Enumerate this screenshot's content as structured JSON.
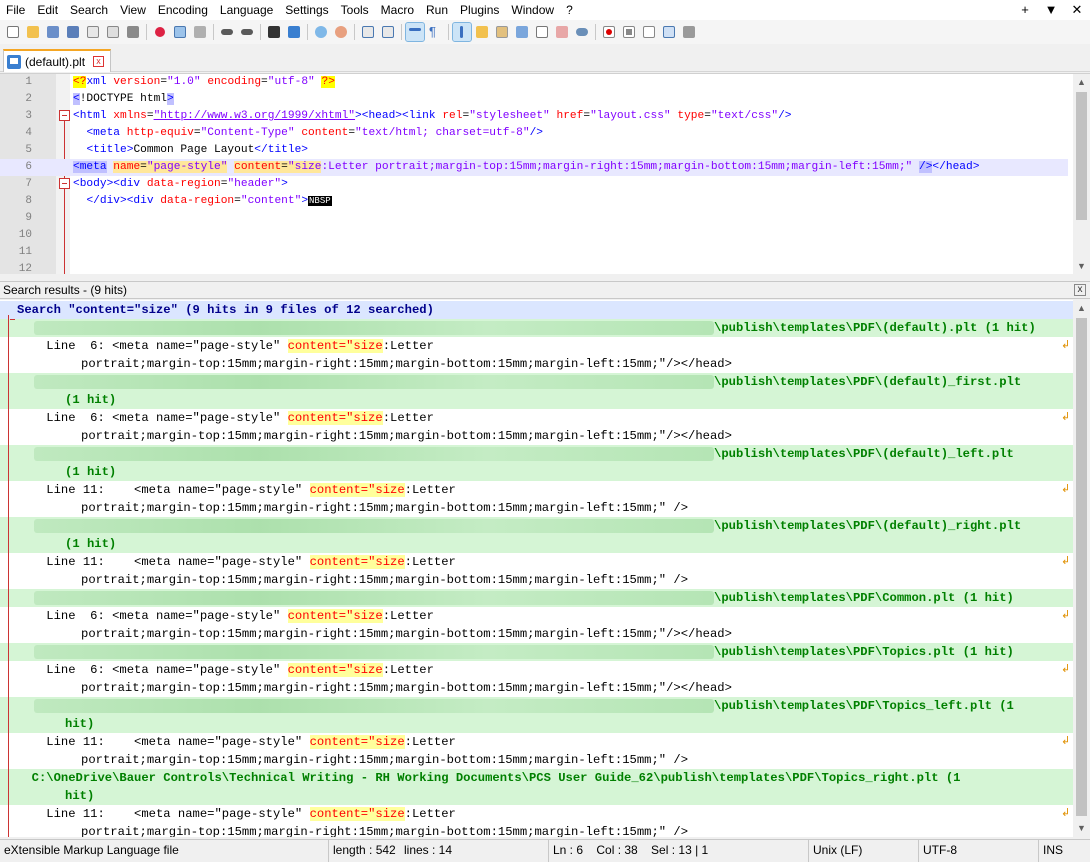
{
  "menu": [
    "File",
    "Edit",
    "Search",
    "View",
    "Encoding",
    "Language",
    "Settings",
    "Tools",
    "Macro",
    "Run",
    "Plugins",
    "Window",
    "?"
  ],
  "window_controls": [
    "+",
    "▼",
    "✕"
  ],
  "toolbar_icons": [
    "new-file-icon",
    "open-file-icon",
    "save-icon",
    "save-all-icon",
    "close-icon",
    "close-all-icon",
    "print-icon",
    "cut-icon",
    "copy-icon",
    "paste-icon",
    "undo-icon",
    "redo-icon",
    "find-icon",
    "replace-icon",
    "zoom-in-icon",
    "zoom-out-icon",
    "sync-vertical-icon",
    "sync-horizontal-icon",
    "word-wrap-icon",
    "show-all-chars-icon",
    "indent-guide-icon",
    "doc-map-icon",
    "function-list-icon",
    "folder-as-workspace-icon",
    "doc-list-icon",
    "monitor-icon",
    "record-macro-icon",
    "stop-record-icon",
    "play-macro-icon",
    "run-macro-multiple-icon",
    "save-macro-icon"
  ],
  "tab": {
    "label": "(default).plt"
  },
  "editor": {
    "line_numbers": [
      "1",
      "2",
      "3",
      "4",
      "5",
      "6",
      "7",
      "8",
      "9",
      "10",
      "11",
      "12"
    ],
    "nbsp": "NBSP"
  },
  "search_panel": {
    "title": "Search results - (9 hits)",
    "close": "x",
    "header": "Search \"content=\"size\" (9 hits in 9 files of 12 searched)",
    "results": [
      {
        "file_lines": [
          "\\publish\\templates\\PDF\\(default).plt (1 hit)"
        ],
        "prefix": "    Line  6: <meta name=\"page-style\" ",
        "match": "content=\"size",
        "suffix": ":Letter",
        "cont": "portrait;margin-top:15mm;margin-right:15mm;margin-bottom:15mm;margin-left:15mm;\"/></head>"
      },
      {
        "file_lines": [
          "\\publish\\templates\\PDF\\(default)_first.plt",
          "(1 hit)"
        ],
        "prefix": "    Line  6: <meta name=\"page-style\" ",
        "match": "content=\"size",
        "suffix": ":Letter",
        "cont": "portrait;margin-top:15mm;margin-right:15mm;margin-bottom:15mm;margin-left:15mm;\"/></head>"
      },
      {
        "file_lines": [
          "\\publish\\templates\\PDF\\(default)_left.plt",
          "(1 hit)"
        ],
        "prefix": "    Line 11:    <meta name=\"page-style\" ",
        "match": "content=\"size",
        "suffix": ":Letter",
        "cont": "portrait;margin-top:15mm;margin-right:15mm;margin-bottom:15mm;margin-left:15mm;\" />"
      },
      {
        "file_lines": [
          "\\publish\\templates\\PDF\\(default)_right.plt",
          "(1 hit)"
        ],
        "prefix": "    Line 11:    <meta name=\"page-style\" ",
        "match": "content=\"size",
        "suffix": ":Letter",
        "cont": "portrait;margin-top:15mm;margin-right:15mm;margin-bottom:15mm;margin-left:15mm;\" />"
      },
      {
        "file_lines": [
          "\\publish\\templates\\PDF\\Common.plt (1 hit)"
        ],
        "prefix": "    Line  6: <meta name=\"page-style\" ",
        "match": "content=\"size",
        "suffix": ":Letter",
        "cont": "portrait;margin-top:15mm;margin-right:15mm;margin-bottom:15mm;margin-left:15mm;\"/></head>"
      },
      {
        "file_lines": [
          "\\publish\\templates\\PDF\\Topics.plt (1 hit)"
        ],
        "prefix": "    Line  6: <meta name=\"page-style\" ",
        "match": "content=\"size",
        "suffix": ":Letter",
        "cont": "portrait;margin-top:15mm;margin-right:15mm;margin-bottom:15mm;margin-left:15mm;\"/></head>"
      },
      {
        "file_lines": [
          "\\publish\\templates\\PDF\\Topics_left.plt (1",
          "hit)"
        ],
        "prefix": "    Line 11:    <meta name=\"page-style\" ",
        "match": "content=\"size",
        "suffix": ":Letter",
        "cont": "portrait;margin-top:15mm;margin-right:15mm;margin-bottom:15mm;margin-left:15mm;\" />"
      },
      {
        "file_lines": [
          "  C:\\OneDrive\\Bauer Controls\\Technical Writing - RH Working Documents\\PCS User Guide_62\\publish\\templates\\PDF\\Topics_right.plt (1",
          "hit)"
        ],
        "prefix": "    Line 11:    <meta name=\"page-style\" ",
        "match": "content=\"size",
        "suffix": ":Letter",
        "cont": "portrait;margin-top:15mm;margin-right:15mm;margin-bottom:15mm;margin-left:15mm;\" />"
      }
    ]
  },
  "status": {
    "filetype": "eXtensible Markup Language file",
    "length": "length : 542",
    "lines": "lines : 14",
    "pos": "Ln : 6    Col : 38    Sel : 13 | 1",
    "eol": "Unix (LF)",
    "encoding": "UTF-8",
    "mode": "INS"
  }
}
